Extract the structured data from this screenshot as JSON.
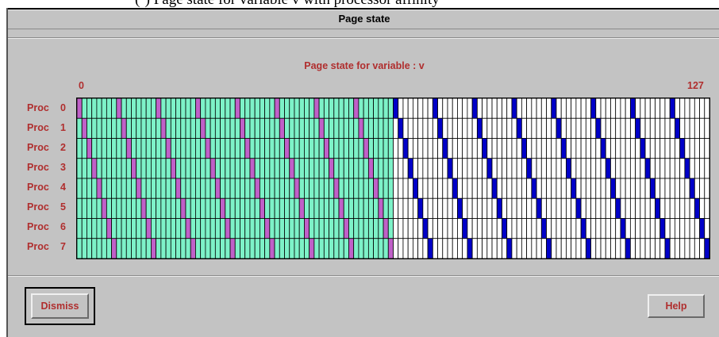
{
  "caption_fragment": "(·)  Page state for variable v  with processor affinity",
  "window": {
    "title": "Page state"
  },
  "plot": {
    "heading": "Page state for variable : v",
    "range_min": "0",
    "range_max": "127",
    "processors": [
      {
        "name": "Proc",
        "number": "0"
      },
      {
        "name": "Proc",
        "number": "1"
      },
      {
        "name": "Proc",
        "number": "2"
      },
      {
        "name": "Proc",
        "number": "3"
      },
      {
        "name": "Proc",
        "number": "4"
      },
      {
        "name": "Proc",
        "number": "5"
      },
      {
        "name": "Proc",
        "number": "6"
      },
      {
        "name": "Proc",
        "number": "7"
      }
    ],
    "page_count": 128,
    "shared_until_page": 64,
    "affinity_period": 8,
    "colors": {
      "shared": "#7df2c8",
      "owned_shared": "#c060c8",
      "unmapped": "#ffffff",
      "owned_local": "#0000c8",
      "gridline": "#000000"
    }
  },
  "buttons": {
    "dismiss": "Dismiss",
    "help": "Help"
  }
}
